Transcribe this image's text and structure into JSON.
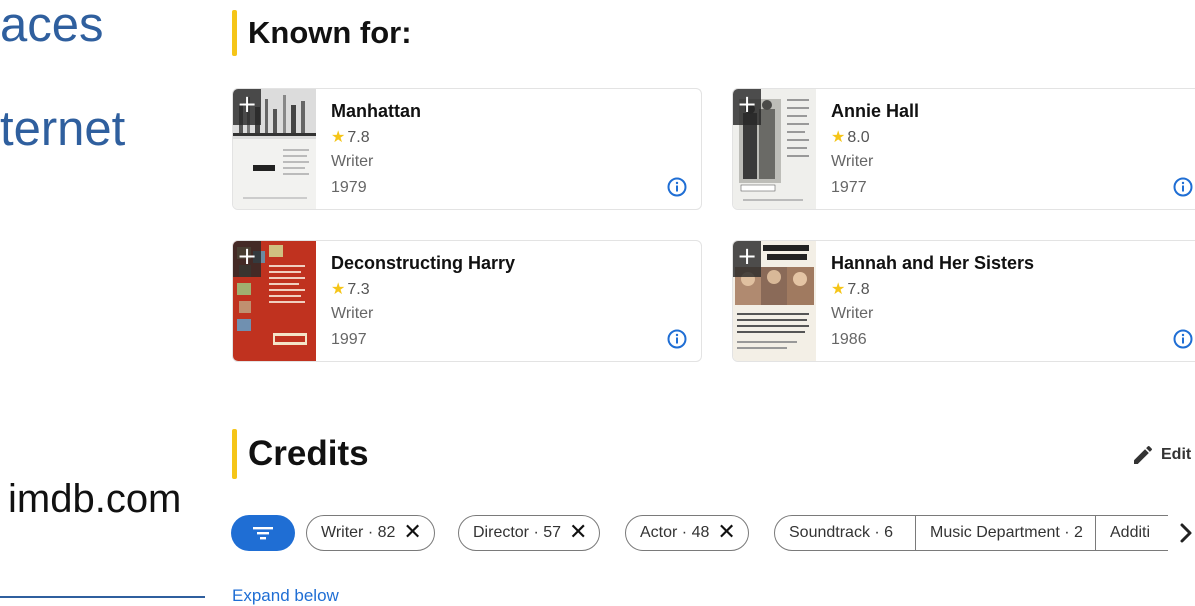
{
  "slide": {
    "line1": "aces",
    "line2": "ternet",
    "site": "imdb.com"
  },
  "known_for": {
    "heading": "Known for:",
    "cards": [
      {
        "title": "Manhattan",
        "rating": "7.8",
        "role": "Writer",
        "year": "1979"
      },
      {
        "title": "Annie Hall",
        "rating": "8.0",
        "role": "Writer",
        "year": "1977"
      },
      {
        "title": "Deconstructing Harry",
        "rating": "7.3",
        "role": "Writer",
        "year": "1997"
      },
      {
        "title": "Hannah and Her Sisters",
        "rating": "7.8",
        "role": "Writer",
        "year": "1986"
      }
    ],
    "add_symbol": "+"
  },
  "credits": {
    "heading": "Credits",
    "edit_label": "Edit",
    "chips": [
      {
        "label": "Writer · 82"
      },
      {
        "label": "Director · 57"
      },
      {
        "label": "Actor · 48"
      }
    ],
    "segments": [
      "Soundtrack · 6",
      "Music Department · 2",
      "Additi"
    ],
    "close_symbol": "✕",
    "expand_label": "Expand below"
  },
  "colors": {
    "accent_yellow": "#f5c518",
    "link_blue": "#1f6ed4",
    "slide_blue": "#2f5f9e"
  }
}
